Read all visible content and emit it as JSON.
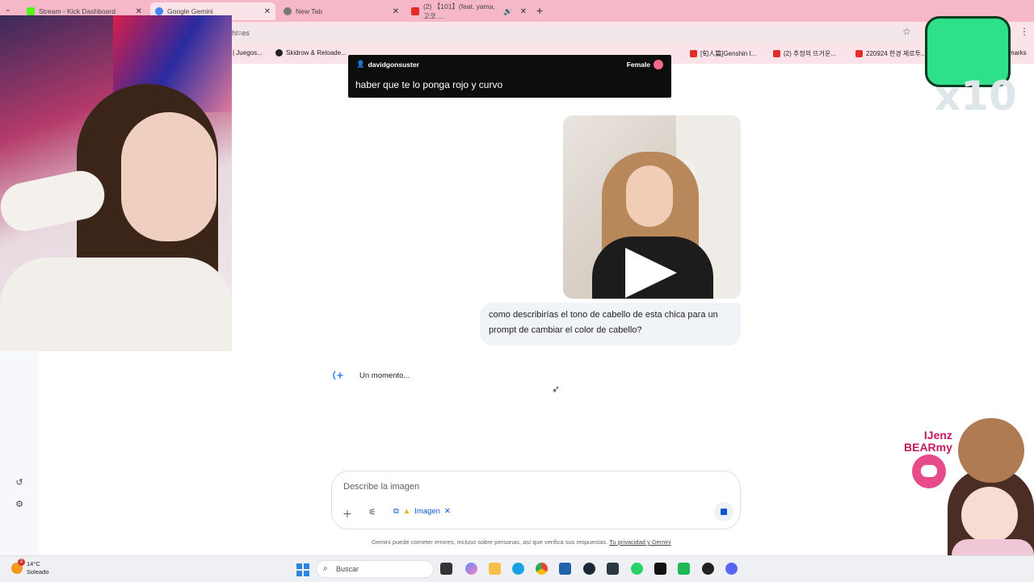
{
  "browser": {
    "tabs": [
      {
        "title": "Stream - Kick Dashboard",
        "color": "#53fc18"
      },
      {
        "title": "Google Gemini",
        "color": "#4285f4"
      },
      {
        "title": "New Tab",
        "color": "#777777"
      },
      {
        "title": "(2) 【101】(feat. yama, 고코 ...",
        "color": "#e52d27"
      }
    ],
    "address": "hl=es",
    "bookmarks": [
      {
        "label": "| Juegos...",
        "color": "#888888"
      },
      {
        "label": "Skidrow & Reloade...",
        "color": "#222222"
      },
      {
        "label": "[旬人篇]Genshin I...",
        "color": "#e52d27"
      },
      {
        "label": "(2) 추정의 뜨거운...",
        "color": "#e52d27"
      },
      {
        "label": "220924 한경 제로투...",
        "color": "#e52d27"
      },
      {
        "label": "ookmarks",
        "color": "#fbe3ea"
      }
    ]
  },
  "chat_overlay": {
    "username": "davidgonsuster",
    "gender": "Female",
    "message": "haber que te lo ponga rojo y curvo"
  },
  "gemini": {
    "user_prompt": "como describirías el tono de cabello de esta chica para un prompt de cambiar el color de cabello?",
    "status": "Un momento...",
    "input_placeholder": "Describe la imagen",
    "chip_label": "Imagen",
    "disclaimer": "Gemini puede cometer errores, incluso sobre personas, así que verifica sus respuestas.",
    "disclaimer_link": "Tu privacidad y Gemini"
  },
  "overlays": {
    "multiplier": "x10",
    "streamer_name_1": "IJenz",
    "streamer_name_2": "BEARmy"
  },
  "taskbar": {
    "temperature": "14°C",
    "weather": "Soleado",
    "weather_badge": "2",
    "search_placeholder": "Buscar"
  }
}
